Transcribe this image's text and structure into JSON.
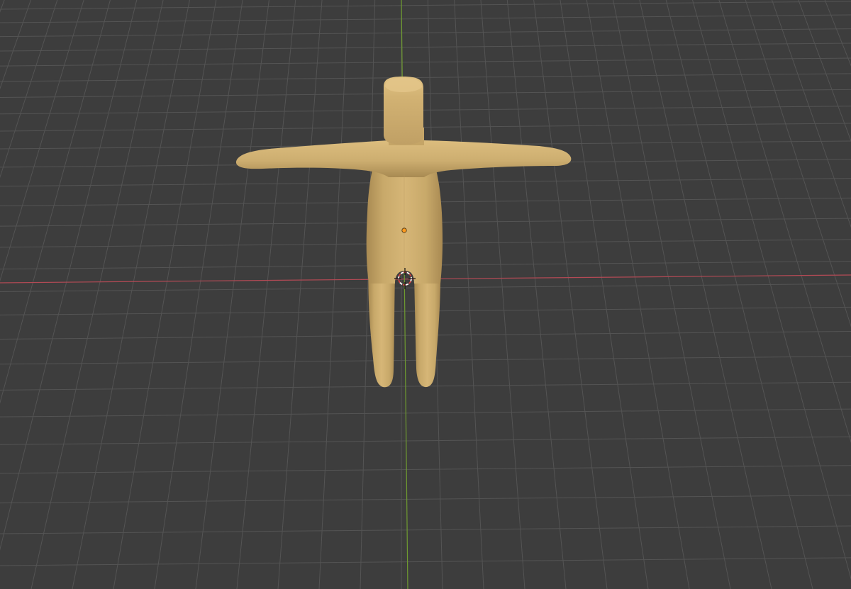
{
  "app": {
    "name": "3D Viewport"
  },
  "viewport": {
    "background_color": "#3d3d3d",
    "grid_line_color": "#545454",
    "x_axis_color": "#b34a55",
    "y_axis_color": "#6f9b30",
    "grid_visible": true
  },
  "object": {
    "kind": "humanoid mesh in T-pose",
    "material_color": "#cfaf6f",
    "shadow_color": "#a8874e",
    "highlight_color": "#e3c688",
    "origin_marker_color": "#ff9a1f"
  },
  "cursor_3d": {
    "icon": "3d-cursor-icon",
    "ring_color_a": "#ffffff",
    "ring_color_b": "#d04040"
  }
}
